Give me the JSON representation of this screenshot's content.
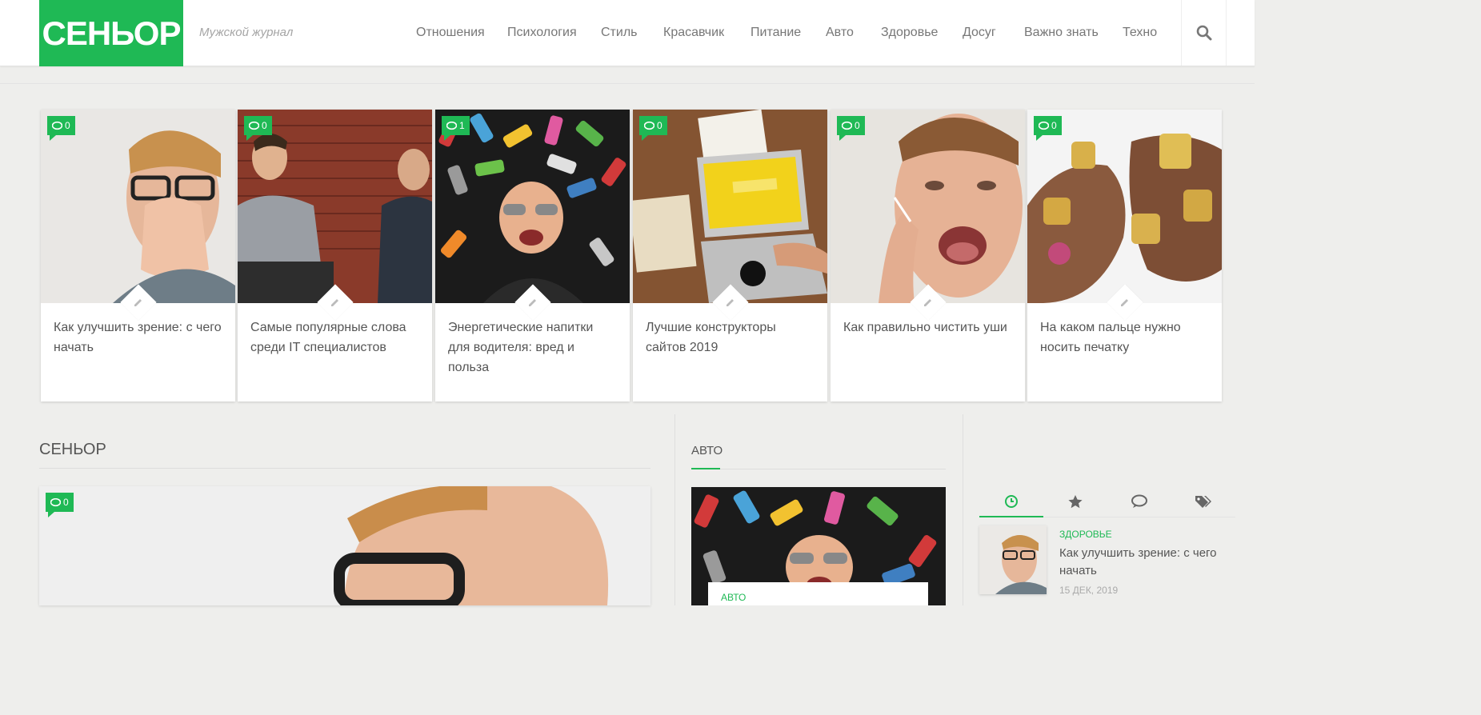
{
  "header": {
    "logo": "СЕНЬОР",
    "tagline": "Мужской журнал",
    "nav": [
      "Отношения",
      "Психология",
      "Стиль",
      "Красавчик",
      "Питание",
      "Авто",
      "Здоровье",
      "Досуг",
      "Важно знать",
      "Техно"
    ],
    "search_icon": "search-icon"
  },
  "cards": [
    {
      "comments": "0",
      "title": "Как улучшить зрение: с чего начать",
      "image": "man-rubbing-eyes-glasses"
    },
    {
      "comments": "0",
      "title": "Самые популярные слова среди IT специалистов",
      "image": "men-at-brick-wall"
    },
    {
      "comments": "1",
      "title": "Энергетические напитки для водителя: вред и польза",
      "image": "man-among-cans"
    },
    {
      "comments": "0",
      "title": "Лучшие конструкторы сайтов 2019",
      "image": "laptop-web-design"
    },
    {
      "comments": "0",
      "title": "Как правильно чистить уши",
      "image": "man-cleaning-ear"
    },
    {
      "comments": "0",
      "title": "На каком пальце нужно носить печатку",
      "image": "hands-with-rings"
    }
  ],
  "main": {
    "section_title": "СЕНЬОР",
    "featured_comments": "0"
  },
  "auto": {
    "section_title": "АВТО",
    "category": "АВТО"
  },
  "sidebar": {
    "tabs": [
      "clock-icon",
      "star-icon",
      "comments-icon",
      "tags-icon"
    ],
    "post": {
      "category": "ЗДОРОВЬЕ",
      "title": "Как улучшить зрение: с чего начать",
      "date": "15 ДЕК, 2019"
    }
  },
  "colors": {
    "accent": "#1fb955",
    "background": "#eeeeec"
  }
}
